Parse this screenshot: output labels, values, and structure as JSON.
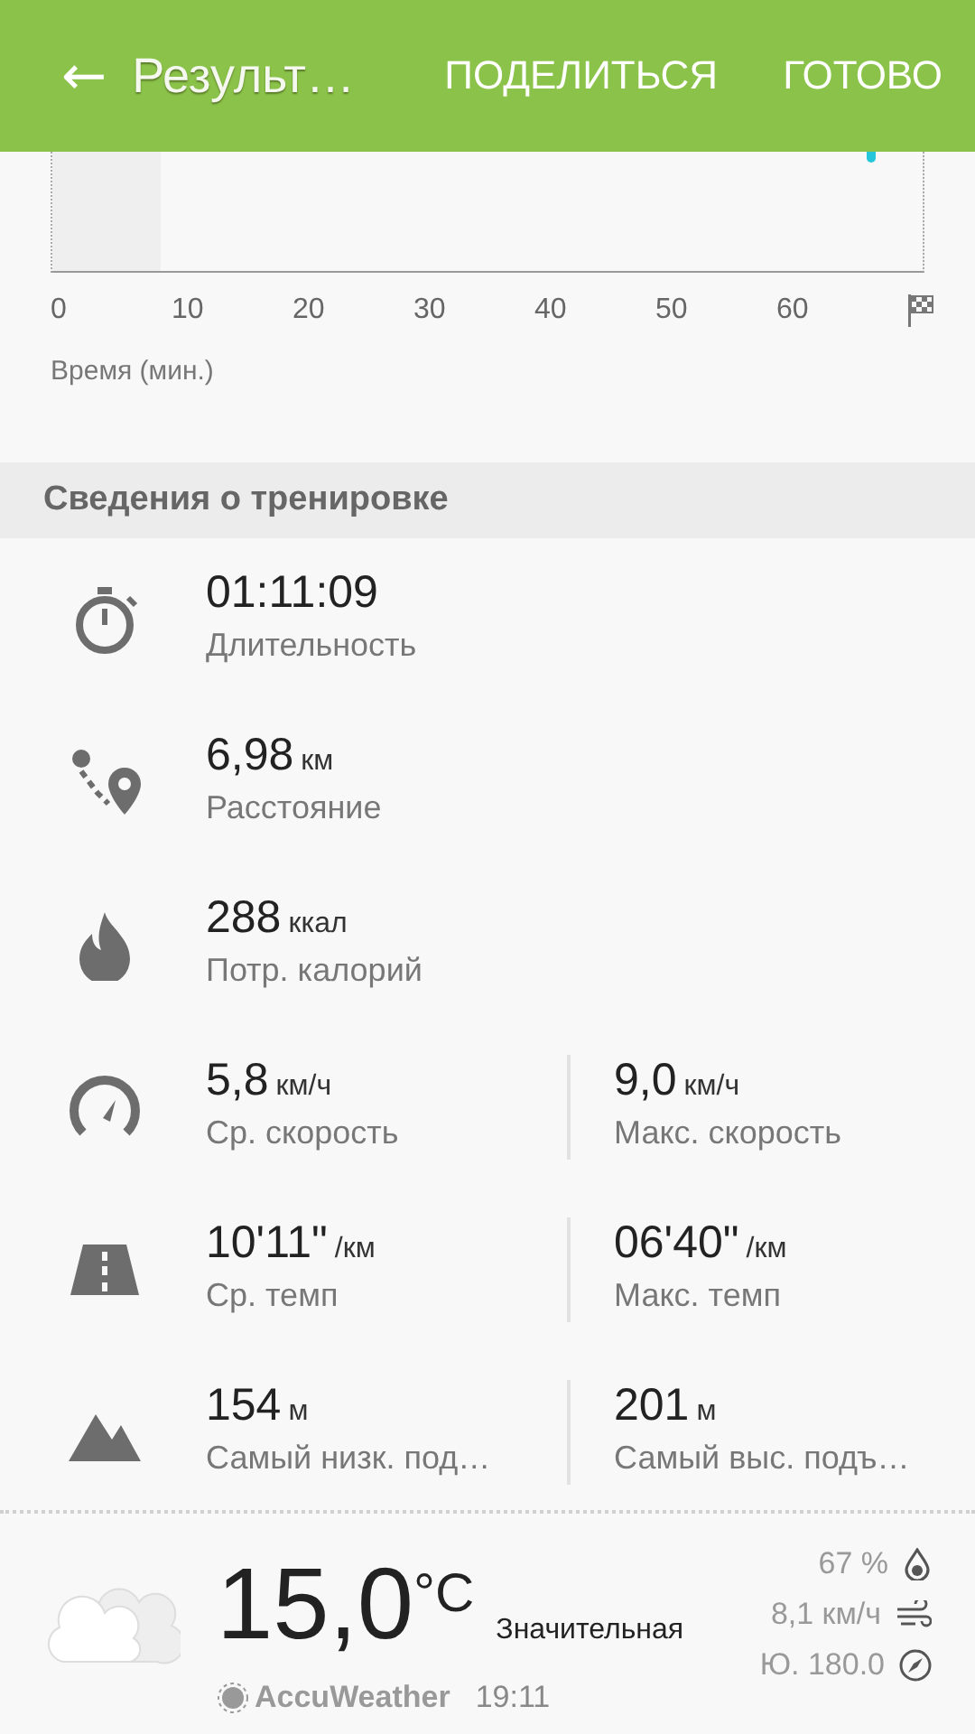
{
  "header": {
    "back": "←",
    "title": "Результ…",
    "actions": [
      "ПОДЕЛИТЬСЯ",
      "ГОТОВО"
    ]
  },
  "chart": {
    "x_ticks": [
      "0",
      "10",
      "20",
      "30",
      "40",
      "50",
      "60"
    ],
    "xlabel": "Время (мин.)"
  },
  "section": {
    "title": "Сведения о тренировке"
  },
  "stats": [
    {
      "kind": "timer",
      "items": [
        {
          "value": "01:11:09",
          "label": "Длительность"
        }
      ]
    },
    {
      "kind": "route",
      "items": [
        {
          "value": "6,98",
          "unit": "км",
          "label": "Расстояние"
        }
      ]
    },
    {
      "kind": "flame",
      "items": [
        {
          "value": "288",
          "unit": "ккал",
          "label": "Потр. калорий"
        }
      ]
    },
    {
      "kind": "speed",
      "items": [
        {
          "value": "5,8",
          "unit": "км/ч",
          "label": "Ср. скорость"
        },
        {
          "value": "9,0",
          "unit": "км/ч",
          "label": "Макс. скорость"
        }
      ]
    },
    {
      "kind": "road",
      "items": [
        {
          "value": "10'11\"",
          "unit": "/км",
          "label": "Ср. темп"
        },
        {
          "value": "06'40\"",
          "unit": "/км",
          "label": "Макс. темп"
        }
      ]
    },
    {
      "kind": "mountain",
      "items": [
        {
          "value": "154",
          "unit": "м",
          "label": "Самый низк. под…"
        },
        {
          "value": "201",
          "unit": "м",
          "label": "Самый выс. подъ…"
        }
      ]
    }
  ],
  "weather": {
    "temperature": "15,0",
    "unit": "°C",
    "condition": "Значительная",
    "provider": "AccuWeather",
    "time": "19:11",
    "humidity": "67 %",
    "wind": "8,1 км/ч",
    "direction": "Ю. 180.0"
  }
}
